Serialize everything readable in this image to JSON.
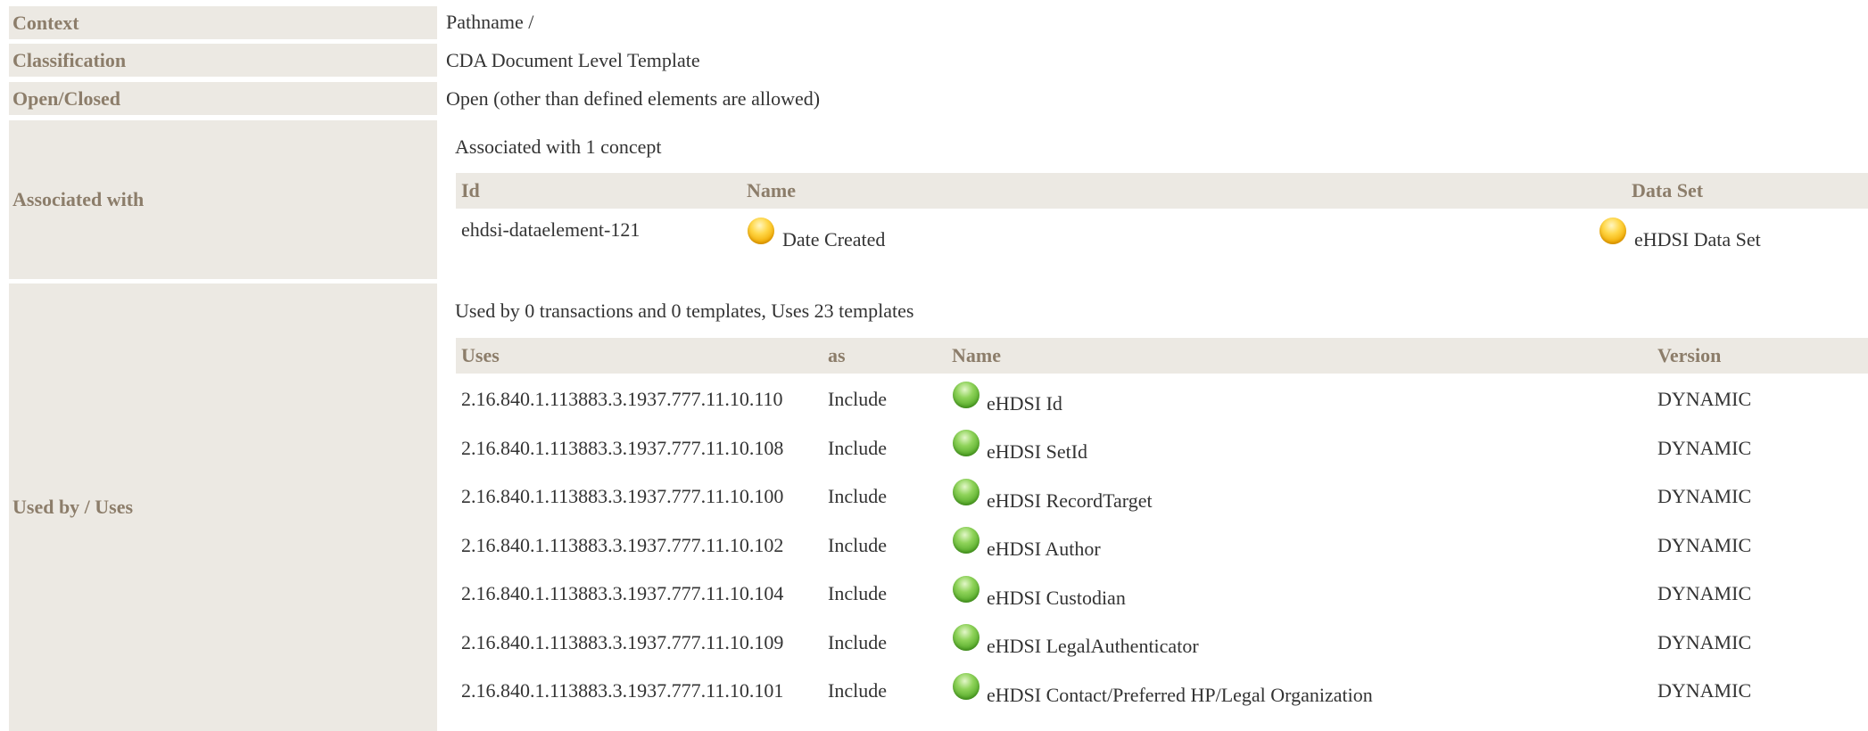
{
  "rows": {
    "context": {
      "label": "Context",
      "value": "Pathname /"
    },
    "classification": {
      "label": "Classification",
      "value": "CDA Document Level Template"
    },
    "open_closed": {
      "label": "Open/Closed",
      "value": "Open (other than defined elements are allowed)"
    },
    "associated_with": {
      "label": "Associated with",
      "summary": "Associated with 1 concept",
      "headers": {
        "id": "Id",
        "name": "Name",
        "dataset": "Data Set"
      },
      "rows": [
        {
          "id": "ehdsi-dataelement-121",
          "name": "Date Created",
          "dataset": "eHDSI Data Set",
          "status_icon": "yellow-circle-icon"
        }
      ]
    },
    "used_by": {
      "label": "Used by / Uses",
      "summary": "Used by 0 transactions and 0 templates, Uses 23 templates",
      "headers": {
        "uses": "Uses",
        "as": "as",
        "name": "Name",
        "version": "Version"
      },
      "rows": [
        {
          "uses": "2.16.840.1.113883.3.1937.777.11.10.110",
          "as": "Include",
          "name": "eHDSI Id",
          "version": "DYNAMIC",
          "status_icon": "green-circle-icon"
        },
        {
          "uses": "2.16.840.1.113883.3.1937.777.11.10.108",
          "as": "Include",
          "name": "eHDSI SetId",
          "version": "DYNAMIC",
          "status_icon": "green-circle-icon"
        },
        {
          "uses": "2.16.840.1.113883.3.1937.777.11.10.100",
          "as": "Include",
          "name": "eHDSI RecordTarget",
          "version": "DYNAMIC",
          "status_icon": "green-circle-icon"
        },
        {
          "uses": "2.16.840.1.113883.3.1937.777.11.10.102",
          "as": "Include",
          "name": "eHDSI Author",
          "version": "DYNAMIC",
          "status_icon": "green-circle-icon"
        },
        {
          "uses": "2.16.840.1.113883.3.1937.777.11.10.104",
          "as": "Include",
          "name": "eHDSI Custodian",
          "version": "DYNAMIC",
          "status_icon": "green-circle-icon"
        },
        {
          "uses": "2.16.840.1.113883.3.1937.777.11.10.109",
          "as": "Include",
          "name": "eHDSI LegalAuthenticator",
          "version": "DYNAMIC",
          "status_icon": "green-circle-icon"
        },
        {
          "uses": "2.16.840.1.113883.3.1937.777.11.10.101",
          "as": "Include",
          "name": "eHDSI Contact/Preferred HP/Legal Organization",
          "version": "DYNAMIC",
          "status_icon": "green-circle-icon"
        }
      ]
    }
  },
  "colors": {
    "label_bg": "#ece9e3",
    "label_text": "#8c7d6a",
    "active_status": "#f2ab00",
    "final_status": "#56ab2a"
  }
}
